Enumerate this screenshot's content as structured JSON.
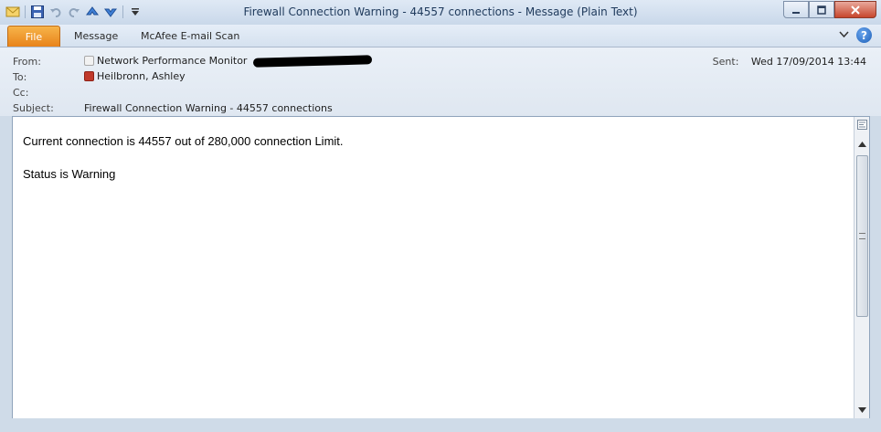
{
  "window": {
    "title": "Firewall Connection Warning - 44557 connections  -  Message (Plain Text)"
  },
  "quick_access_icons": [
    "mail-icon",
    "save-icon",
    "undo-icon",
    "redo-icon",
    "previous-item-icon",
    "next-item-icon",
    "customize-qat-icon"
  ],
  "ribbon": {
    "file_label": "File",
    "tabs": [
      "Message",
      "McAfee E-mail Scan"
    ]
  },
  "header": {
    "from_label": "From:",
    "from_value": "Network Performance Monitor",
    "to_label": "To:",
    "to_value": "Heilbronn, Ashley",
    "cc_label": "Cc:",
    "subject_label": "Subject:",
    "subject_value": "Firewall Connection Warning - 44557 connections",
    "sent_label": "Sent:",
    "sent_value": "Wed 17/09/2014 13:44"
  },
  "body": {
    "line1": "Current connection is 44557 out of 280,000 connection Limit.",
    "line2": "Status is Warning"
  },
  "colors": {
    "file_tab": "#e8831a",
    "title_text": "#1e395b",
    "close_button": "#c7462c"
  }
}
